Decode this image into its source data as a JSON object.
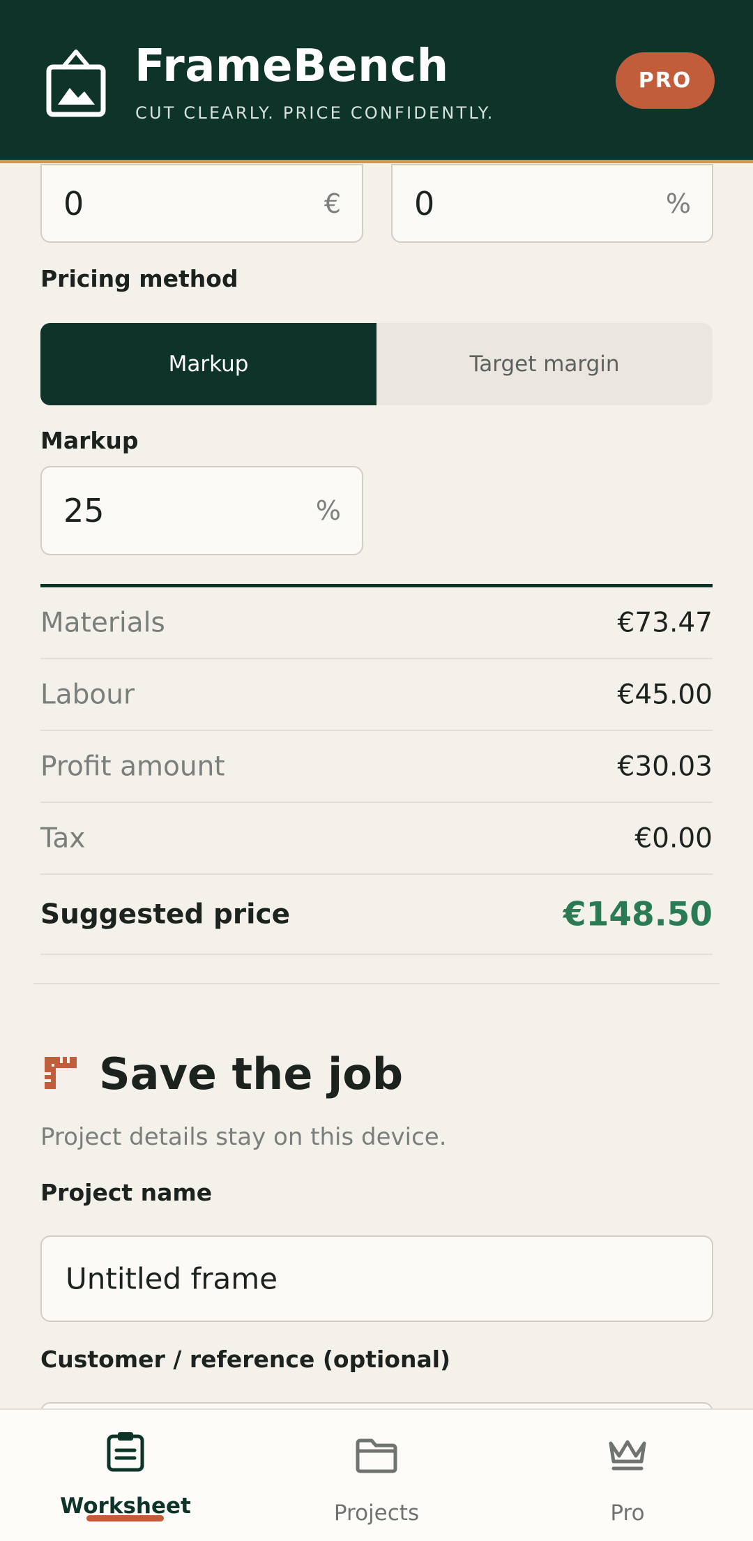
{
  "header": {
    "brand": "FrameBench",
    "tagline": "CUT CLEARLY. PRICE CONFIDENTLY.",
    "badge": "PRO"
  },
  "top_fields": [
    {
      "value": "0",
      "unit": "€"
    },
    {
      "value": "0",
      "unit": "%"
    }
  ],
  "pricing": {
    "method_label": "Pricing method",
    "options": [
      "Markup",
      "Target margin"
    ],
    "selected": "Markup",
    "markup_label": "Markup",
    "markup_value": "25",
    "markup_unit": "%"
  },
  "summary": [
    {
      "label": "Materials",
      "value": "€73.47"
    },
    {
      "label": "Labour",
      "value": "€45.00"
    },
    {
      "label": "Profit amount",
      "value": "€30.03"
    },
    {
      "label": "Tax",
      "value": "€0.00"
    }
  ],
  "suggested": {
    "label": "Suggested price",
    "value": "€148.50"
  },
  "save": {
    "title": "Save the job",
    "subtitle": "Project details stay on this device.",
    "project_name_label": "Project name",
    "project_name_value": "Untitled frame",
    "customer_label": "Customer / reference (optional)"
  },
  "nav": {
    "items": [
      {
        "label": "Worksheet",
        "icon": "clipboard-icon",
        "active": true
      },
      {
        "label": "Projects",
        "icon": "folder-icon",
        "active": false
      },
      {
        "label": "Pro",
        "icon": "crown-icon",
        "active": false
      }
    ]
  },
  "colors": {
    "primary": "#0e342a",
    "accent": "#c25d3c",
    "gold": "#c99a4a",
    "success": "#2a7a53",
    "background": "#f4f0ea"
  }
}
